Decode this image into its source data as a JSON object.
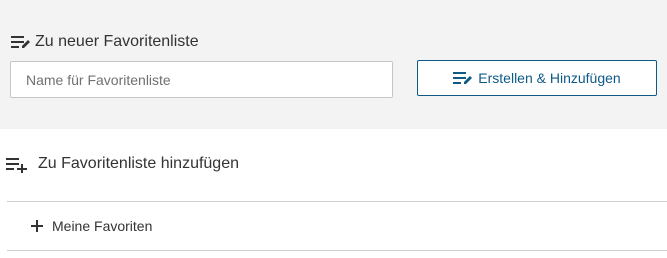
{
  "new_list": {
    "heading": "Zu neuer Favoritenliste",
    "heading_icon": "playlist-edit-icon",
    "input": {
      "value": "",
      "placeholder": "Name für Favoritenliste"
    },
    "create_button": {
      "label": "Erstellen & Hinzufügen",
      "icon": "playlist-edit-icon"
    }
  },
  "add_to_list": {
    "heading": "Zu Favoritenliste hinzufügen",
    "heading_icon": "playlist-add-icon",
    "lists": [
      {
        "label": "Meine Favoriten",
        "icon": "plus-icon"
      }
    ]
  },
  "colors": {
    "panel_background": "#f3f3f3",
    "accent": "#0e5a86",
    "text": "#333333",
    "divider": "#cfcfcf"
  }
}
